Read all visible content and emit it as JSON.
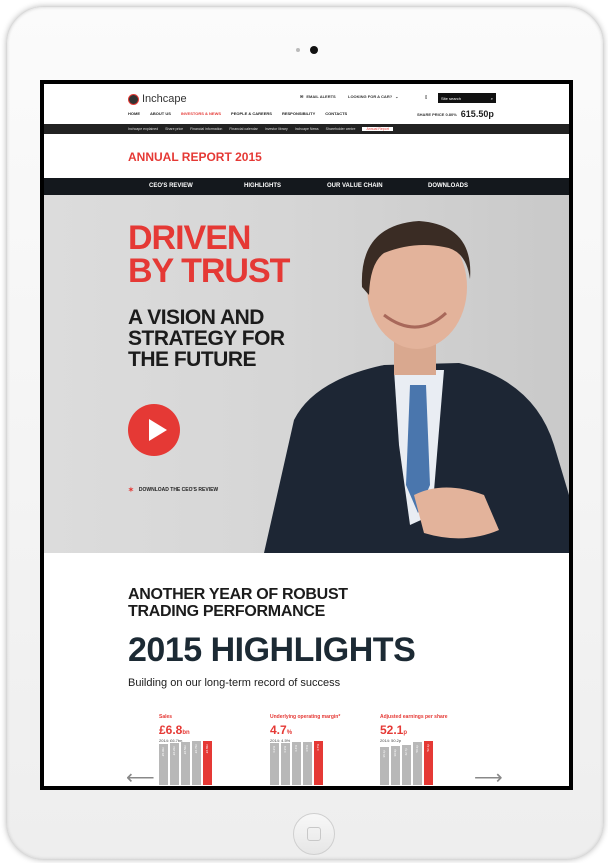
{
  "site": {
    "logo": "Inchcape",
    "email_alerts": "EMAIL ALERTS",
    "car_prompt": "LOOKING FOR A CAR?",
    "search_placeholder": "Site search",
    "share_price_label": "SHARE PRICE 0.80%",
    "share_price_value": "615.50p"
  },
  "nav": [
    "HOME",
    "ABOUT US",
    "INVESTORS & NEWS",
    "PEOPLE & CAREERS",
    "RESPONSIBILITY",
    "CONTACTS"
  ],
  "subnav": [
    "Inchcape explained",
    "Share price",
    "Financial information",
    "Financial calendar",
    "Investor library",
    "Inchcape News",
    "Shareholder centre",
    "Annual Report"
  ],
  "annual_report_title": "ANNUAL REPORT 2015",
  "tabs": [
    "CEO'S REVIEW",
    "HIGHLIGHTS",
    "OUR VALUE CHAIN",
    "DOWNLOADS"
  ],
  "hero": {
    "headline1": "DRIVEN",
    "headline2": "BY TRUST",
    "sub1": "A VISION AND",
    "sub2": "STRATEGY FOR",
    "sub3": "THE FUTURE",
    "download": "DOWNLOAD THE CEO'S REVIEW"
  },
  "highlights": {
    "line1": "ANOTHER YEAR OF ROBUST",
    "line2": "TRADING PERFORMANCE",
    "title": "2015 HIGHLIGHTS",
    "tagline": "Building on our long-term record of success",
    "metrics": [
      {
        "label": "Sales",
        "value": "£6.8",
        "unit": "bn",
        "prev": "2014: £6.7bn",
        "bars": [
          {
            "v": 5.9,
            "t": "£5.9bn"
          },
          {
            "v": 6.2,
            "t": "£6.2bn"
          },
          {
            "v": 6.5,
            "t": "£6.5bn"
          },
          {
            "v": 6.7,
            "t": "£6.7bn"
          },
          {
            "v": 6.8,
            "t": "£6.8bn"
          }
        ]
      },
      {
        "label": "Underlying operating margin*",
        "value": "4.7",
        "unit": "%",
        "prev": "2014: 4.5%",
        "bars": [
          {
            "v": 4.2,
            "t": "4.2%"
          },
          {
            "v": 4.3,
            "t": "4.3%"
          },
          {
            "v": 4.4,
            "t": "4.4%"
          },
          {
            "v": 4.5,
            "t": "4.5%"
          },
          {
            "v": 4.7,
            "t": "4.7%"
          }
        ]
      },
      {
        "label": "Adjusted earnings per share",
        "value": "52.1",
        "unit": "p",
        "prev": "2014: 50.2p",
        "bars": [
          {
            "v": 36.1,
            "t": "36.1p"
          },
          {
            "v": 39.9,
            "t": "39.9p"
          },
          {
            "v": 42.7,
            "t": "42.7p"
          },
          {
            "v": 50.2,
            "t": "50.2p"
          },
          {
            "v": 52.1,
            "t": "52.1p"
          }
        ]
      }
    ]
  },
  "colors": {
    "accent": "#e53935",
    "dark": "#14181d"
  }
}
